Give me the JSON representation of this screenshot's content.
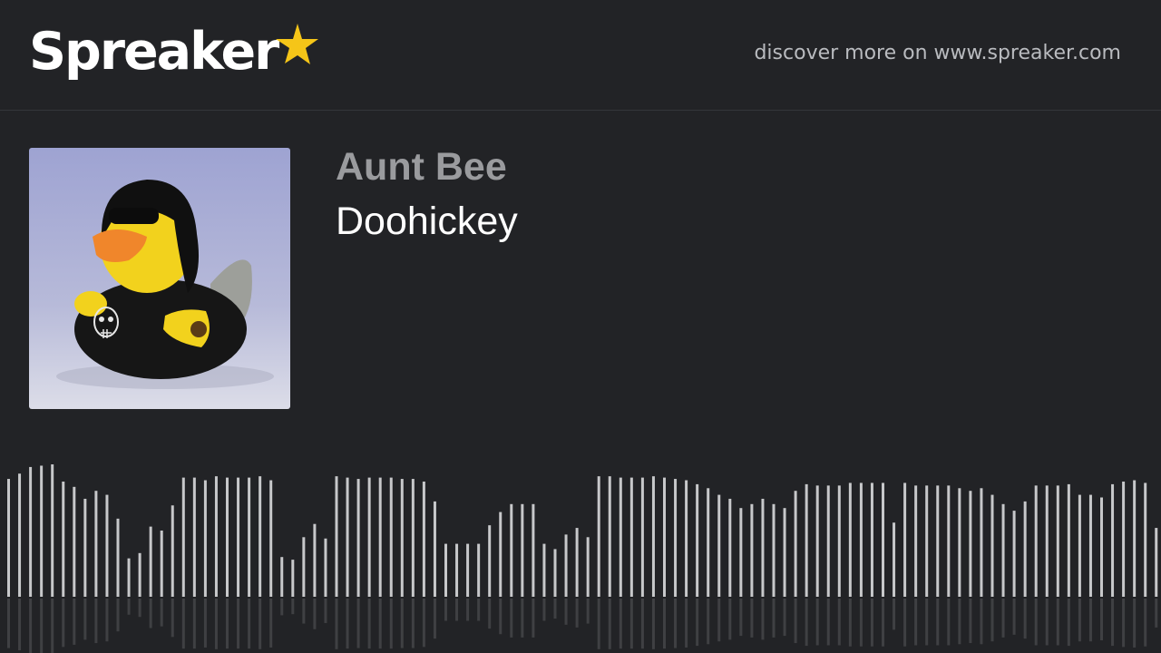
{
  "brand": {
    "name": "Spreaker",
    "star_color": "#f5c518"
  },
  "header": {
    "discover_text": "discover more on www.spreaker.com"
  },
  "episode": {
    "show_title": "Aunt Bee",
    "episode_title": "Doohickey",
    "cover_icon": "rubber-duck-cover-art"
  },
  "waveform": {
    "bar_color": "#c7c8ca",
    "levels": [
      0.89,
      0.93,
      0.98,
      0.99,
      1.0,
      0.87,
      0.83,
      0.74,
      0.8,
      0.77,
      0.59,
      0.29,
      0.33,
      0.53,
      0.5,
      0.69,
      0.9,
      0.9,
      0.88,
      0.91,
      0.9,
      0.9,
      0.9,
      0.91,
      0.88,
      0.3,
      0.28,
      0.45,
      0.55,
      0.44,
      0.91,
      0.9,
      0.89,
      0.9,
      0.9,
      0.9,
      0.89,
      0.89,
      0.87,
      0.72,
      0.4,
      0.4,
      0.4,
      0.4,
      0.54,
      0.64,
      0.7,
      0.7,
      0.7,
      0.4,
      0.36,
      0.47,
      0.52,
      0.45,
      0.91,
      0.91,
      0.9,
      0.9,
      0.9,
      0.91,
      0.9,
      0.89,
      0.88,
      0.85,
      0.82,
      0.77,
      0.74,
      0.67,
      0.7,
      0.74,
      0.7,
      0.67,
      0.8,
      0.85,
      0.84,
      0.84,
      0.84,
      0.86,
      0.86,
      0.86,
      0.86,
      0.56,
      0.86,
      0.84,
      0.84,
      0.84,
      0.84,
      0.82,
      0.8,
      0.82,
      0.77,
      0.7,
      0.65,
      0.72,
      0.84,
      0.84,
      0.84,
      0.85,
      0.77,
      0.77,
      0.75,
      0.85,
      0.87,
      0.88,
      0.86,
      0.52,
      0.02
    ]
  }
}
